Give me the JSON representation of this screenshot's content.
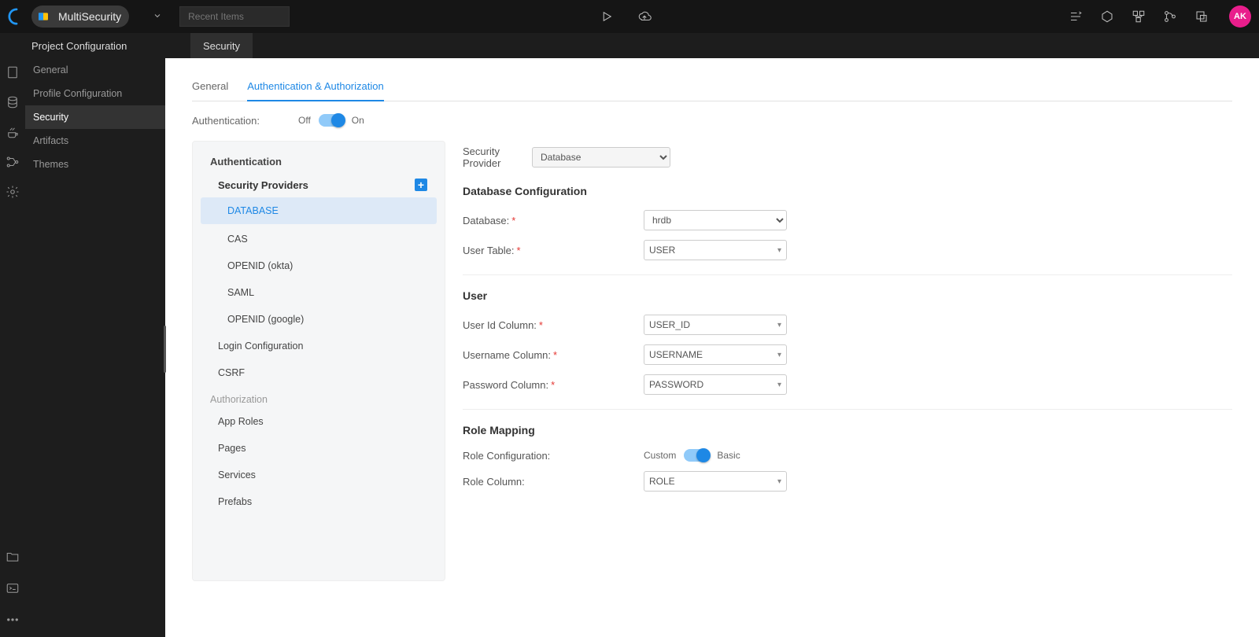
{
  "topbar": {
    "project_name": "MultiSecurity",
    "recent_placeholder": "Recent Items",
    "avatar": "AK"
  },
  "secondbar": {
    "side_title": "Project Configuration",
    "tab": "Security"
  },
  "sidebar": {
    "items": [
      {
        "label": "General",
        "selected": false
      },
      {
        "label": "Profile Configuration",
        "selected": false
      },
      {
        "label": "Security",
        "selected": true
      },
      {
        "label": "Artifacts",
        "selected": false
      },
      {
        "label": "Themes",
        "selected": false
      }
    ]
  },
  "main": {
    "tabs": {
      "general": "General",
      "auth": "Authentication & Authorization"
    },
    "authn_label": "Authentication:",
    "off": "Off",
    "on": "On",
    "panel": {
      "auth_header": "Authentication",
      "sec_providers": "Security Providers",
      "providers": [
        {
          "label": "DATABASE",
          "selected": true
        },
        {
          "label": "CAS"
        },
        {
          "label": "OPENID (okta)"
        },
        {
          "label": "SAML"
        },
        {
          "label": "OPENID (google)"
        }
      ],
      "login_config": "Login Configuration",
      "csrf": "CSRF",
      "authz_header": "Authorization",
      "authz_items": [
        {
          "label": "App Roles"
        },
        {
          "label": "Pages"
        },
        {
          "label": "Services"
        },
        {
          "label": "Prefabs"
        }
      ]
    },
    "form": {
      "security_provider_label": "Security Provider",
      "security_provider_value": "Database",
      "db_config_header": "Database Configuration",
      "database_label": "Database:",
      "database_value": "hrdb",
      "user_table_label": "User Table:",
      "user_table_value": "USER",
      "user_header": "User",
      "user_id_label": "User Id Column:",
      "user_id_value": "USER_ID",
      "username_label": "Username Column:",
      "username_value": "USERNAME",
      "password_label": "Password Column:",
      "password_value": "PASSWORD",
      "role_mapping_header": "Role Mapping",
      "role_config_label": "Role Configuration:",
      "role_custom": "Custom",
      "role_basic": "Basic",
      "role_column_label": "Role Column:",
      "role_column_value": "ROLE"
    }
  }
}
